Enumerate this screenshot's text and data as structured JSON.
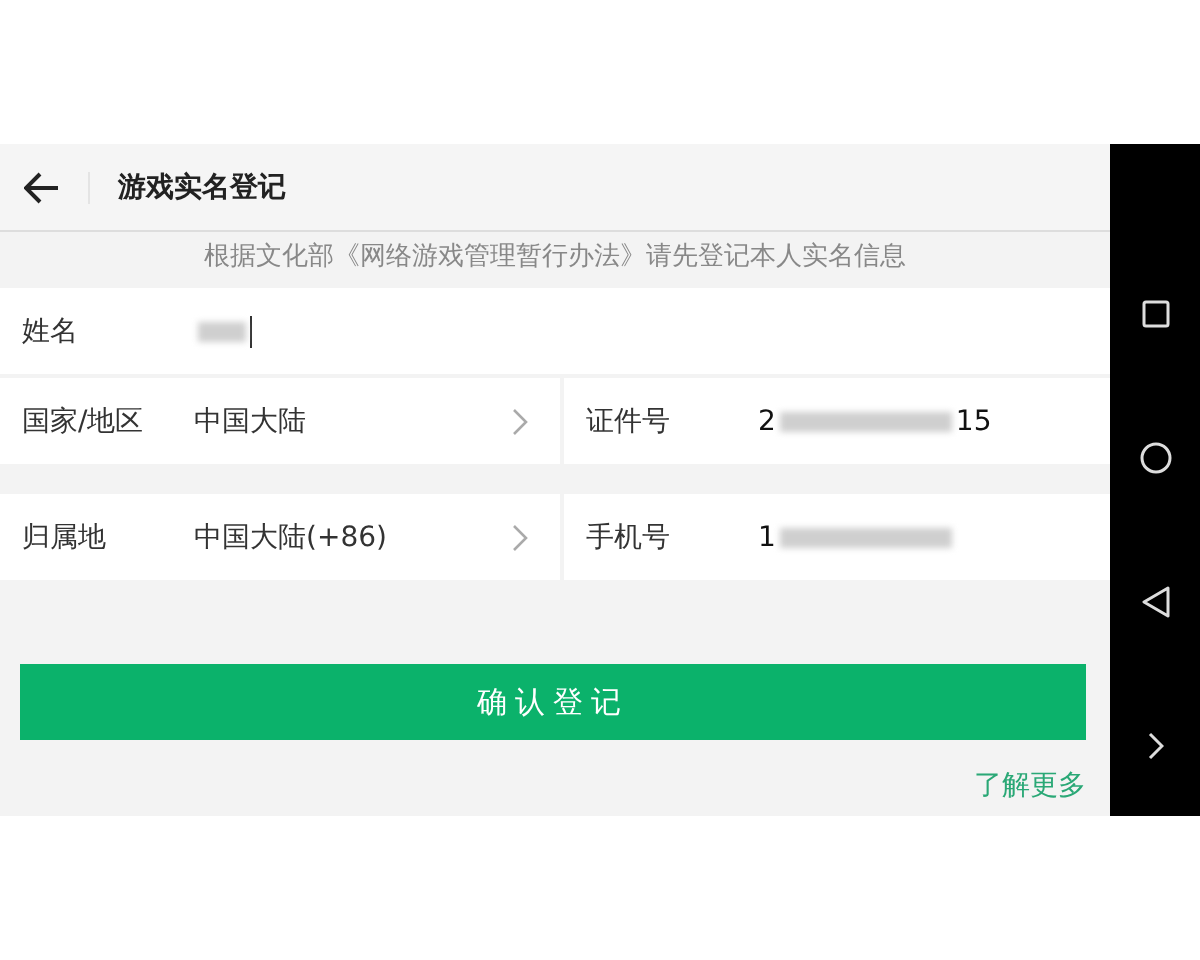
{
  "header": {
    "title": "游戏实名登记"
  },
  "notice": "根据文化部《网络游戏管理暂行办法》请先登记本人实名信息",
  "name_row": {
    "label": "姓名",
    "blurred": true
  },
  "rows": [
    {
      "left": {
        "label": "国家/地区",
        "value": "中国大陆"
      },
      "right": {
        "label": "证件号",
        "value_prefix": "2",
        "value_suffix": "15",
        "blurred": true
      }
    },
    {
      "left": {
        "label": "归属地",
        "value": "中国大陆(+86)"
      },
      "right": {
        "label": "手机号",
        "value_prefix": "1",
        "blurred": true
      }
    }
  ],
  "confirm_button": "确认登记",
  "learn_more_link": "了解更多",
  "nav_bar": [
    {
      "kind": "square"
    },
    {
      "kind": "circle"
    },
    {
      "kind": "triangle"
    },
    {
      "kind": "chevron"
    }
  ]
}
